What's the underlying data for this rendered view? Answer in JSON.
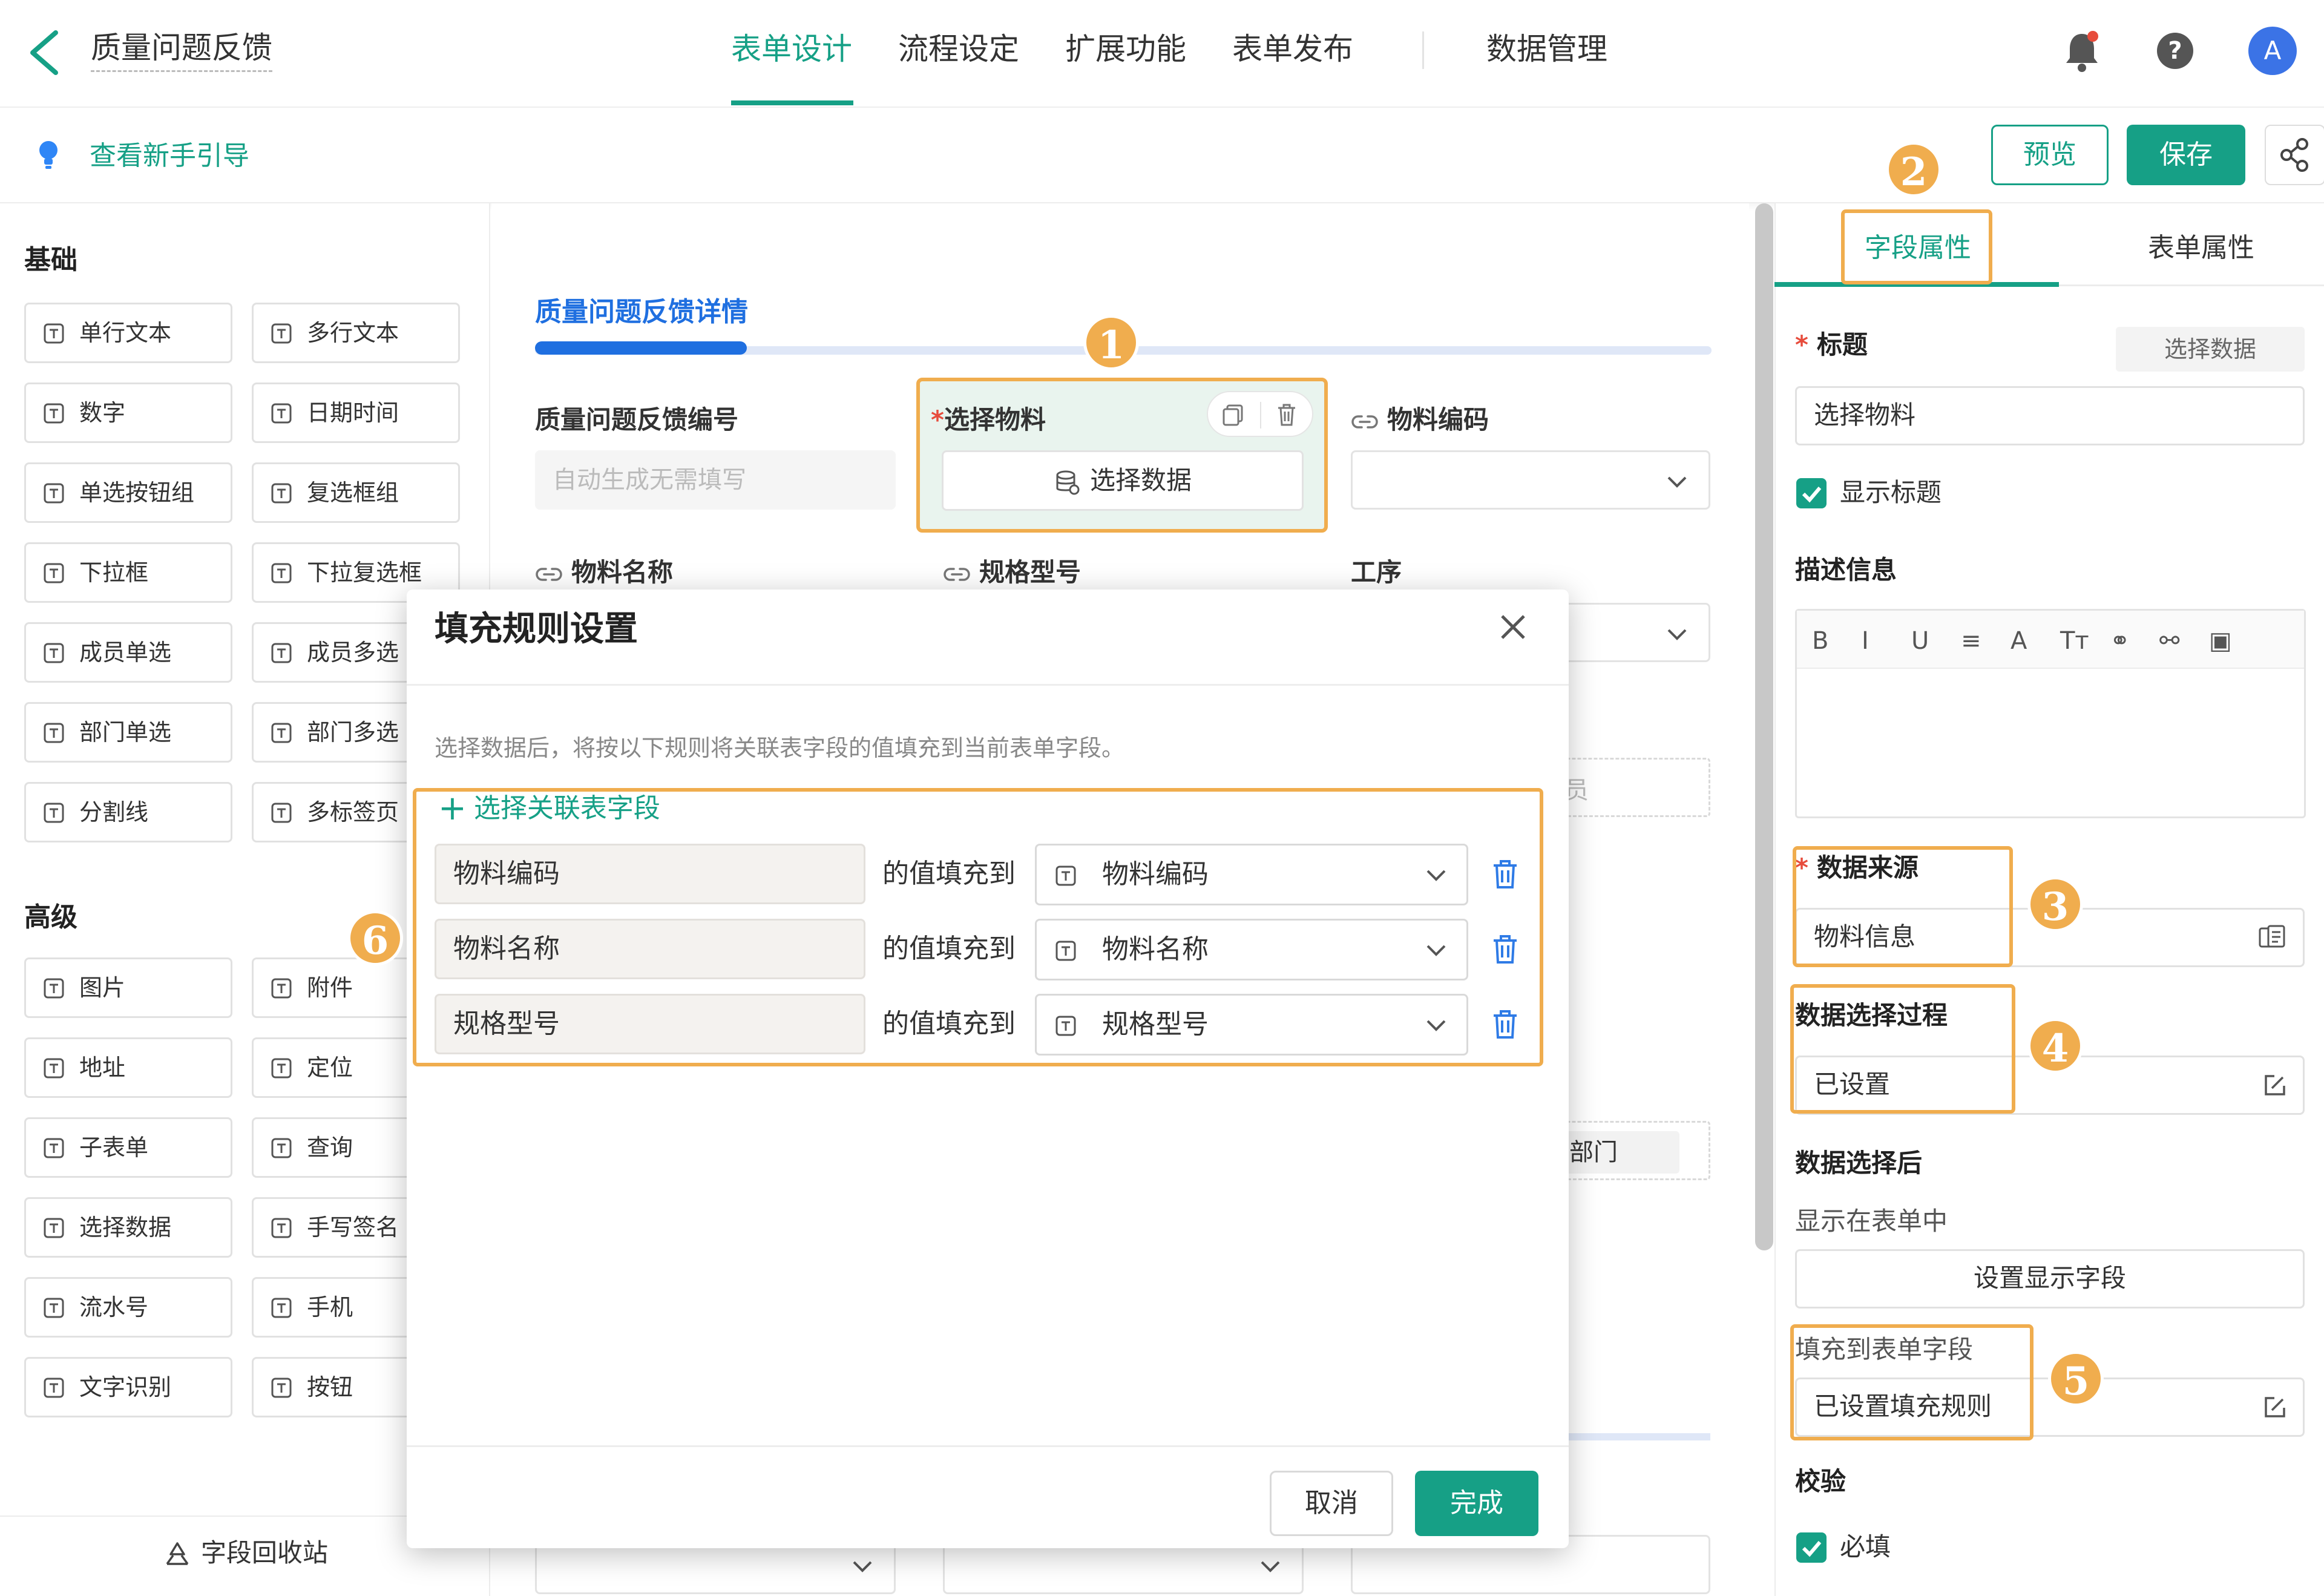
{
  "header": {
    "title": "质量问题反馈",
    "tabs": [
      "表单设计",
      "流程设定",
      "扩展功能",
      "表单发布"
    ],
    "data_manage": "数据管理",
    "avatar": "A"
  },
  "subbar": {
    "guide": "查看新手引导",
    "preview": "预览",
    "save": "保存"
  },
  "left": {
    "basic_title": "基础",
    "basic": [
      "单行文本",
      "多行文本",
      "数字",
      "日期时间",
      "单选按钮组",
      "复选框组",
      "下拉框",
      "下拉复选框",
      "成员单选",
      "成员多选",
      "部门单选",
      "部门多选",
      "分割线",
      "多标签页"
    ],
    "advanced_title": "高级",
    "advanced": [
      "图片",
      "附件",
      "地址",
      "定位",
      "子表单",
      "查询",
      "选择数据",
      "手写签名",
      "流水号",
      "手机",
      "文字识别",
      "按钮"
    ],
    "recycle": "字段回收站"
  },
  "canvas": {
    "section": "质量问题反馈详情",
    "f_code": "质量问题反馈编号",
    "f_code_ph": "自动生成无需填写",
    "f_select": "选择物料",
    "f_select_btn": "选择数据",
    "f_matcode": "物料编码",
    "f_matname": "物料名称",
    "f_spec": "规格型号",
    "f_proc": "工序",
    "partial1": "员",
    "partial2": "门",
    "partial3": "部门"
  },
  "badges": [
    "1",
    "2",
    "3",
    "4",
    "5",
    "6"
  ],
  "right": {
    "tabs": [
      "字段属性",
      "表单属性"
    ],
    "title_label": "标题",
    "title_btn": "选择数据",
    "title_value": "选择物料",
    "show_title": "显示标题",
    "desc_label": "描述信息",
    "toolbar": [
      "B",
      "I",
      "U",
      "≡",
      "A",
      "Tт",
      "⚭",
      "⚯",
      "▣"
    ],
    "source_label": "数据来源",
    "source_value": "物料信息",
    "process_label": "数据选择过程",
    "process_value": "已设置",
    "after_label": "数据选择后",
    "show_in_form": "显示在表单中",
    "set_display": "设置显示字段",
    "fill_label": "填充到表单字段",
    "fill_value": "已设置填充规则",
    "validate": "校验",
    "required": "必填"
  },
  "modal": {
    "title": "填充规则设置",
    "desc": "选择数据后，将按以下规则将关联表字段的值填充到当前表单字段。",
    "add": "选择关联表字段",
    "fill_to": "的值填充到",
    "rules": [
      {
        "src": "物料编码",
        "dst": "物料编码"
      },
      {
        "src": "物料名称",
        "dst": "物料名称"
      },
      {
        "src": "规格型号",
        "dst": "规格型号"
      }
    ],
    "cancel": "取消",
    "done": "完成"
  },
  "colors": {
    "accent": "#16a086",
    "highlight": "#f0ad4e",
    "section": "#1f6fe0"
  }
}
